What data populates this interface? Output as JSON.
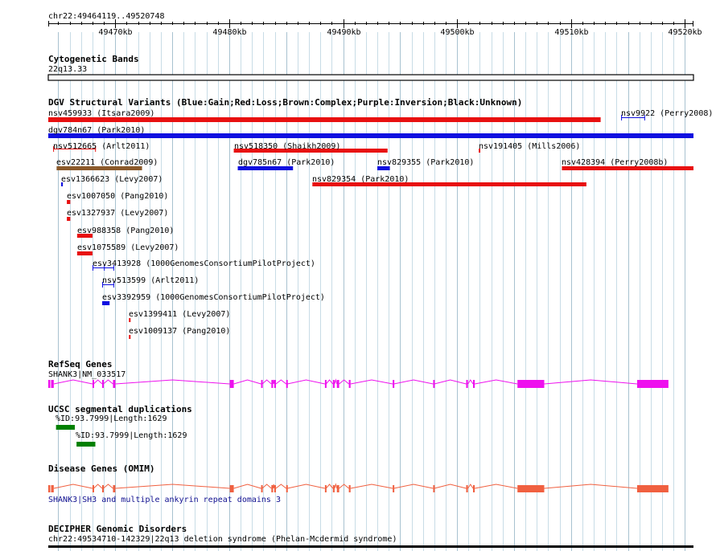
{
  "ruler": {
    "region_label": "chr22:49464119..49520748",
    "start": 49464119,
    "end": 49520748,
    "ticks": [
      {
        "pos": 49470000,
        "label": "49470kb"
      },
      {
        "pos": 49480000,
        "label": "49480kb"
      },
      {
        "pos": 49490000,
        "label": "49490kb"
      },
      {
        "pos": 49500000,
        "label": "49500kb"
      },
      {
        "pos": 49510000,
        "label": "49510kb"
      },
      {
        "pos": 49520000,
        "label": "49520kb"
      }
    ]
  },
  "cytoband": {
    "title": "Cytogenetic Bands",
    "label": "22q13.33"
  },
  "dgv": {
    "title": "DGV Structural Variants (Blue:Gain;Red:Loss;Brown:Complex;Purple:Inversion;Black:Unknown)",
    "colors": {
      "gain": "#1010e0",
      "loss": "#e81010",
      "complex": "#8b5a2b"
    },
    "items": [
      {
        "label": "nsv459933 (Itsara2009)",
        "start": 49464119,
        "end": 49512600,
        "type": "loss",
        "style": "thick"
      },
      {
        "label": "nsv9922 (Perry2008)",
        "start": 49514400,
        "end": 49516500,
        "type": "gain",
        "style": "span"
      },
      {
        "label": "dgv784n67 (Park2010)",
        "start": 49464119,
        "end": 49520748,
        "type": "gain",
        "style": "thick"
      },
      {
        "label": "nsv512665 (Arlt2011)",
        "start": 49464550,
        "end": 49468300,
        "type": "loss",
        "style": "span"
      },
      {
        "label": "nsv518350 (Shaikh2009)",
        "start": 49480400,
        "end": 49493900,
        "type": "loss",
        "style": "thin"
      },
      {
        "label": "nsv191405 (Mills2006)",
        "start": 49501900,
        "end": 49502000,
        "type": "loss",
        "style": "thin"
      },
      {
        "label": "esv22211 (Conrad2009)",
        "start": 49464850,
        "end": 49472350,
        "type": "complex",
        "style": "thin"
      },
      {
        "label": "dgv785n67 (Park2010)",
        "start": 49480750,
        "end": 49485600,
        "type": "gain",
        "style": "thin"
      },
      {
        "label": "nsv829355 (Park2010)",
        "start": 49493000,
        "end": 49494100,
        "type": "gain",
        "style": "thin"
      },
      {
        "label": "nsv428394 (Perry2008b)",
        "start": 49509200,
        "end": 49520748,
        "type": "loss",
        "style": "thin"
      },
      {
        "label": "esv1366623 (Levy2007)",
        "start": 49465250,
        "end": 49465400,
        "type": "gain",
        "style": "thin"
      },
      {
        "label": "nsv829354 (Park2010)",
        "start": 49487300,
        "end": 49511350,
        "type": "loss",
        "style": "thin"
      },
      {
        "label": "esv1007050 (Pang2010)",
        "start": 49465750,
        "end": 49466050,
        "type": "loss",
        "style": "thin"
      },
      {
        "label": "esv1327937 (Levy2007)",
        "start": 49465750,
        "end": 49466050,
        "type": "loss",
        "style": "thin"
      },
      {
        "label": "esv988358 (Pang2010)",
        "start": 49466650,
        "end": 49468000,
        "type": "loss",
        "style": "thin"
      },
      {
        "label": "esv1075589 (Levy2007)",
        "start": 49466650,
        "end": 49468000,
        "type": "loss",
        "style": "thin"
      },
      {
        "label": "esv3413928 (1000GenomesConsortiumPilotProject)",
        "start": 49468000,
        "end": 49469900,
        "type": "gain",
        "style": "split"
      },
      {
        "label": "nsv513599 (Arlt2011)",
        "start": 49468850,
        "end": 49469900,
        "type": "gain",
        "style": "span"
      },
      {
        "label": "esv3392959 (1000GenomesConsortiumPilotProject)",
        "start": 49468850,
        "end": 49469500,
        "type": "gain",
        "style": "thin"
      },
      {
        "label": "esv1399411 (Levy2007)",
        "start": 49471200,
        "end": 49471330,
        "type": "loss",
        "style": "thin"
      },
      {
        "label": "esv1009137 (Pang2010)",
        "start": 49471200,
        "end": 49471330,
        "type": "loss",
        "style": "thin"
      }
    ]
  },
  "refseq": {
    "title": "RefSeq Genes",
    "gene_label": "SHANK3|NM_033517",
    "color": "#ee10ee",
    "start": 49464119,
    "end": 49518550,
    "exons": [
      [
        49464119,
        49464600
      ],
      [
        49468000,
        49468100
      ],
      [
        49468850,
        49468950
      ],
      [
        49469800,
        49470000
      ],
      [
        49480050,
        49480400
      ],
      [
        49482800,
        49482900
      ],
      [
        49483700,
        49483850
      ],
      [
        49483950,
        49484100
      ],
      [
        49485000,
        49485100
      ],
      [
        49488400,
        49488500
      ],
      [
        49489100,
        49489250
      ],
      [
        49489450,
        49489650
      ],
      [
        49490500,
        49490650
      ],
      [
        49494350,
        49494450
      ],
      [
        49497900,
        49498000
      ],
      [
        49500800,
        49500950
      ],
      [
        49501400,
        49501550
      ],
      [
        49505300,
        49507650
      ],
      [
        49515800,
        49518550
      ]
    ]
  },
  "segdup": {
    "title": "UCSC segmental duplications",
    "color": "#008000",
    "items": [
      {
        "label": "%ID:93.7999|Length:1629",
        "start": 49464800,
        "end": 49466450
      },
      {
        "label": "%ID:93.7999|Length:1629",
        "start": 49466600,
        "end": 49468250
      }
    ]
  },
  "omim": {
    "title": "Disease Genes (OMIM)",
    "gene_label": "SHANK3|SH3 and multiple ankyrin repeat domains 3",
    "color": "#f06040",
    "label_color": "#101090"
  },
  "decipher": {
    "title": "DECIPHER Genomic Disorders",
    "label": "chr22:49534710-142329|22q13 deletion syndrome (Phelan-Mcdermid syndrome)"
  }
}
